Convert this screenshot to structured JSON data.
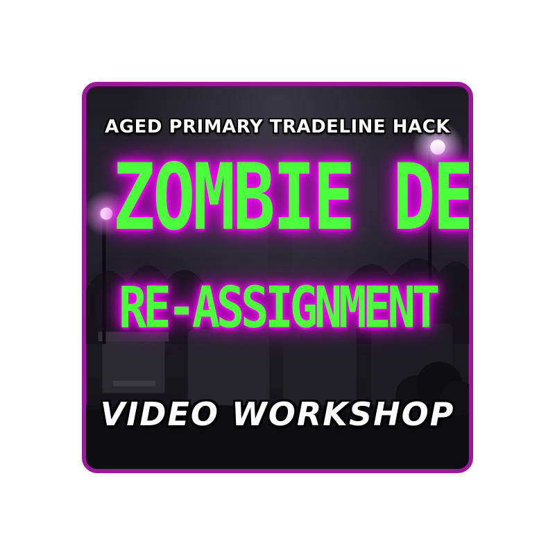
{
  "product": {
    "tagline": "AGED PRIMARY TRADELINE HACK",
    "headline": "ZOMBIE DEBT",
    "subheadline": "RE-ASSIGNMENT",
    "footer_label": "VIDEO WORKSHOP"
  },
  "colors": {
    "frame": "#9b1a9c",
    "headline_fill": "#4cff3b",
    "headline_glow": "#ff00ff",
    "label_text": "#ffffff",
    "background": "#1d1c22"
  },
  "icons": {
    "lamp_left": "glowing-lamp-icon",
    "lamp_right": "glowing-lamp-icon",
    "tombstone": "tombstone-icon"
  }
}
